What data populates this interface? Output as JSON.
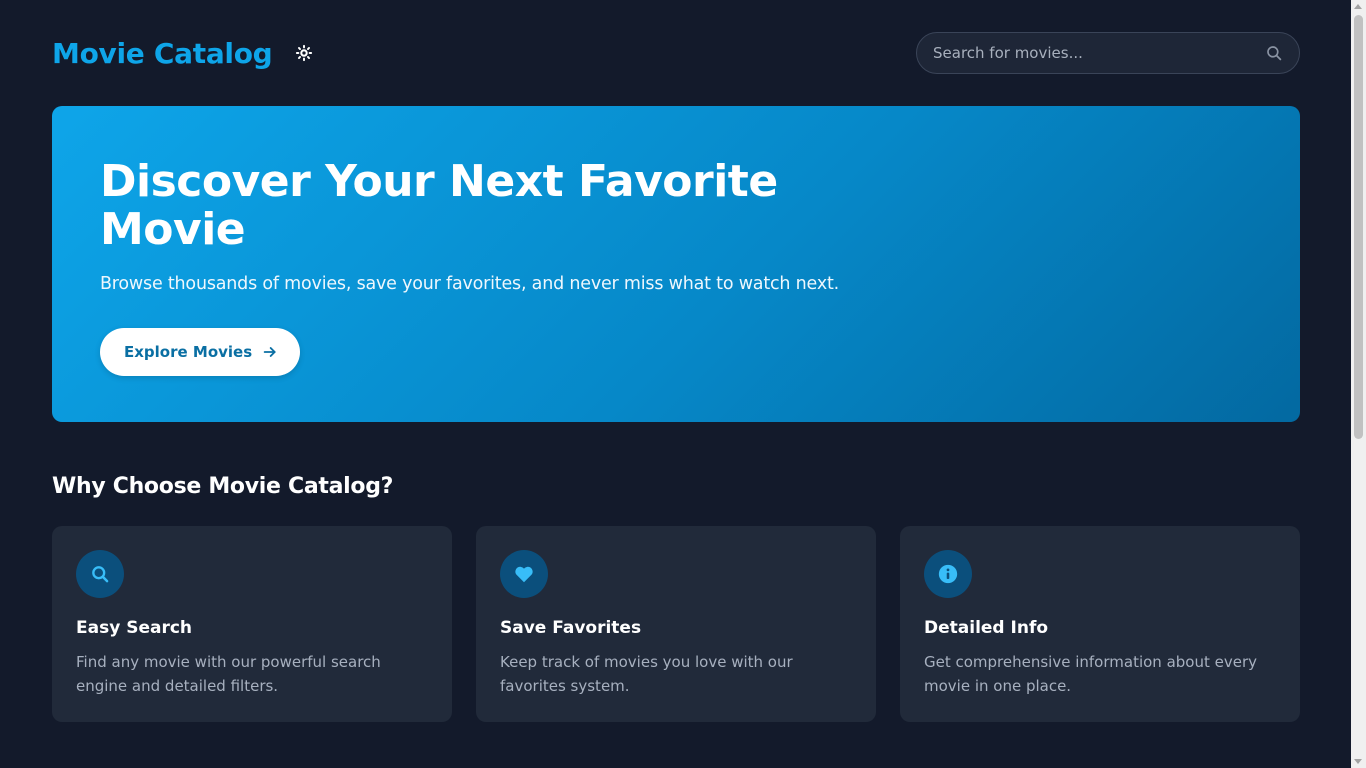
{
  "header": {
    "brand_title": "Movie Catalog",
    "theme_toggle_icon": "sun-icon",
    "search": {
      "placeholder": "Search for movies...",
      "value": "",
      "icon": "search-icon"
    }
  },
  "hero": {
    "title": "Discover Your Next Favorite Movie",
    "subtitle": "Browse thousands of movies, save your favorites, and never miss what to watch next.",
    "button_label": "Explore Movies",
    "button_icon": "arrow-right-icon"
  },
  "features": {
    "section_title": "Why Choose Movie Catalog?",
    "cards": [
      {
        "icon": "search-icon",
        "title": "Easy Search",
        "text": "Find any movie with our powerful search engine and detailed filters."
      },
      {
        "icon": "heart-icon",
        "title": "Save Favorites",
        "text": "Keep track of movies you love with our favorites system."
      },
      {
        "icon": "info-icon",
        "title": "Detailed Info",
        "text": "Get comprehensive information about every movie in one place."
      }
    ]
  },
  "colors": {
    "background": "#131a2b",
    "accent": "#0ea5e9",
    "card_background": "#212a3a",
    "icon_circle": "#0b4f7c",
    "icon_color": "#38bdf8"
  }
}
